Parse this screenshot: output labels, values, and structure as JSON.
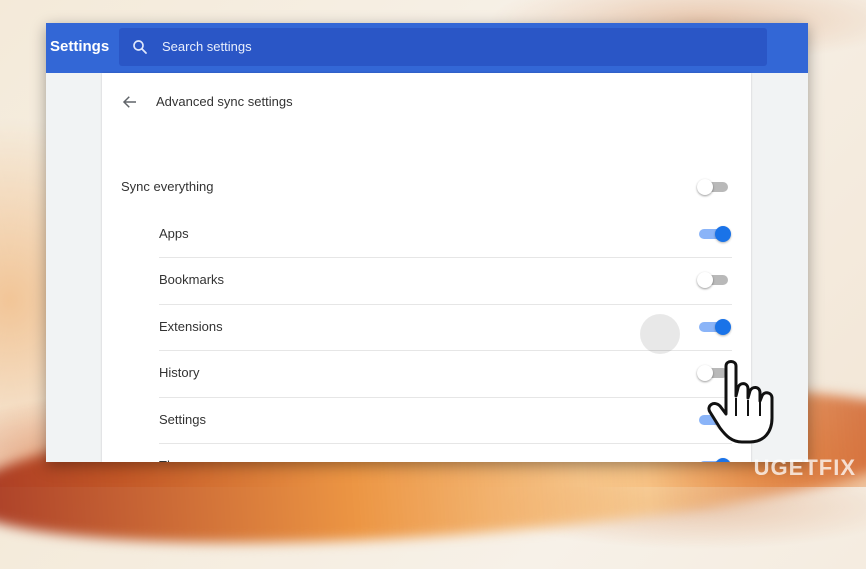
{
  "header": {
    "title": "Settings",
    "search_placeholder": "Search settings"
  },
  "page": {
    "title": "Advanced sync settings"
  },
  "sync": {
    "everything": {
      "label": "Sync everything",
      "enabled": false
    },
    "items": [
      {
        "label": "Apps",
        "enabled": true
      },
      {
        "label": "Bookmarks",
        "enabled": false
      },
      {
        "label": "Extensions",
        "enabled": true
      },
      {
        "label": "History",
        "enabled": false
      },
      {
        "label": "Settings",
        "enabled": true
      },
      {
        "label": "Themes",
        "enabled": true
      }
    ]
  },
  "watermark": "UGETFIX",
  "colors": {
    "header": "#3367d6",
    "search_box": "#2a56c6",
    "toggle_on": "#1a73e8",
    "toggle_on_track": "#8ab4f8",
    "toggle_off_track": "#b9b9b9"
  },
  "icons": {
    "search": "search-icon",
    "back": "arrow-back-icon",
    "cursor": "hand-pointer-icon"
  }
}
